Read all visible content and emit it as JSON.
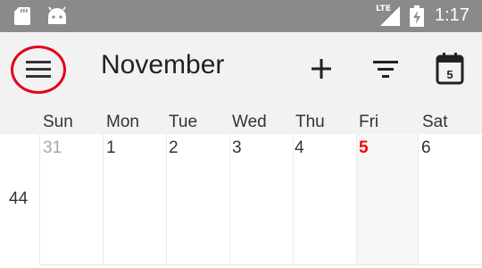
{
  "status_bar": {
    "network_label": "LTE",
    "time": "1:17",
    "icons": [
      "sd-card-icon",
      "android-icon",
      "signal-icon",
      "battery-charging-icon"
    ]
  },
  "toolbar": {
    "menu_icon": "hamburger-menu-icon",
    "title": "November",
    "add_icon": "plus-icon",
    "filter_icon": "filter-icon",
    "today_icon": "calendar-today-icon",
    "today_day": "5"
  },
  "weekdays": [
    "Sun",
    "Mon",
    "Tue",
    "Wed",
    "Thu",
    "Fri",
    "Sat"
  ],
  "week": {
    "number": "44",
    "days": [
      "31",
      "1",
      "2",
      "3",
      "4",
      "5",
      "6"
    ],
    "outside_month_index": 0,
    "today_index": 5
  },
  "colors": {
    "status_bar": "#8a8a8a",
    "toolbar_bg": "#f2f2f2",
    "today_text": "#ff0000",
    "highlight_ring": "#e3001b",
    "muted_text": "#a8a8a8"
  }
}
